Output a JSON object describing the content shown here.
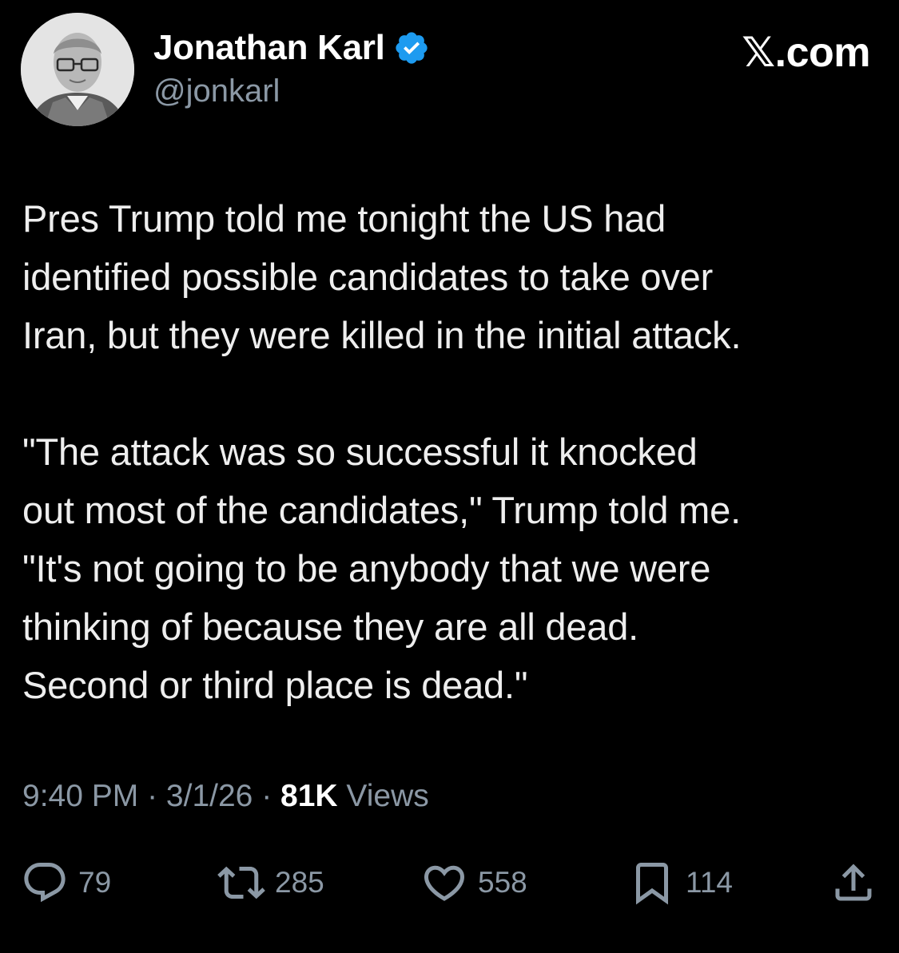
{
  "author": {
    "display_name": "Jonathan Karl",
    "handle": "@jonkarl",
    "verified": true,
    "verified_color": "#1d9bf0"
  },
  "brand": "𝕏.com",
  "tweet": {
    "paragraph1": [
      "Pres Trump told me tonight the US had",
      "identified possible candidates to take over",
      "Iran, but they were killed in the initial attack."
    ],
    "paragraph2": [
      "\"The attack was so successful it knocked",
      "out most of the candidates,\" Trump told me.",
      "\"It's not going to be anybody that we were",
      "thinking of because they are all dead.",
      "Second or third place is dead.\""
    ]
  },
  "meta": {
    "time": "9:40 PM",
    "sep1": " · ",
    "date": "3/1/26",
    "sep2": " · ",
    "views_count": "81K",
    "views_label": " Views"
  },
  "actions": {
    "replies": "79",
    "reposts": "285",
    "likes": "558",
    "bookmarks": "114"
  },
  "icons": {
    "reply": "reply-icon",
    "repost": "repost-icon",
    "like": "heart-icon",
    "bookmark": "bookmark-icon",
    "share": "share-icon",
    "verified": "verified-badge-icon"
  }
}
